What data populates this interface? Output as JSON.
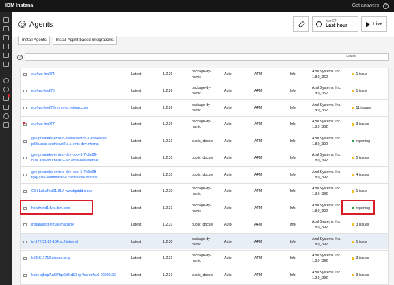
{
  "topbar": {
    "brand": "IBM Instana",
    "get_answers": "Get answers"
  },
  "header": {
    "title": "Agents",
    "time_date": "Mar 07",
    "time_range": "Last hour",
    "live_label": "Live"
  },
  "actions": {
    "install_agents": "Install Agents",
    "install_integrations": "Install Agent-based Integrations"
  },
  "toolbar": {
    "help_glyph": "?",
    "filters_label": "Filters"
  },
  "status_colors": {
    "warning": "#f1c21b",
    "ok": "#24a148"
  },
  "rows": [
    {
      "host": "eu-hws-lnx274",
      "version": "Latest",
      "agent_ver": "1.2.26",
      "pkg1": "package-dy-",
      "pkg2": "namic",
      "mode": "Auto",
      "type": "APM",
      "level": "Info",
      "jvm1": "Azul Systems, Inc.",
      "jvm2": "1.8.0_362",
      "status": "1 issue",
      "status_type": "warning"
    },
    {
      "host": "eu-hws-lnx275",
      "version": "Latest",
      "agent_ver": "1.2.26",
      "pkg1": "package-dy-",
      "pkg2": "namic",
      "mode": "Auto",
      "type": "APM",
      "level": "Info",
      "jvm1": "Azul Systems, Inc.",
      "jvm2": "1.8.0_362",
      "status": "1 issue",
      "status_type": "warning"
    },
    {
      "host": "eu-hws-lnx276.nonprod.hclpnp.com",
      "version": "Latest",
      "agent_ver": "1.2.26",
      "pkg1": "package-dy-",
      "pkg2": "namic",
      "mode": "Auto",
      "type": "APM",
      "level": "Info",
      "jvm1": "Azul Systems, Inc.",
      "jvm2": "1.8.0_362",
      "status": "11 issues",
      "status_type": "warning"
    },
    {
      "host": "eu-hws-lnx277",
      "version": "Latest",
      "agent_ver": "1.2.26",
      "pkg1": "package-dy-",
      "pkg2": "namic",
      "mode": "Auto",
      "type": "APM",
      "level": "Info",
      "jvm1": "Azul Systems, Inc.",
      "jvm2": "1.8.0_362",
      "status": "3 issues",
      "status_type": "warning",
      "alert": true
    },
    {
      "host": "gke-privateks-emis-d-elasticsearch-1-e5e4d2ad-",
      "host2": "p3da.asia-southeast2-a.c.emis-dev.internal",
      "version": "Latest",
      "agent_ver": "1.2.31",
      "pkg1": "public_docker",
      "pkg2": "",
      "mode": "Auto",
      "type": "APM",
      "level": "Info",
      "jvm1": "Azul Systems, Inc.",
      "jvm2": "1.8.0_392",
      "status": "reporting",
      "status_type": "ok"
    },
    {
      "host": "gke-privateks-emis-d-dev-pool-5-7fc8e9ff-",
      "host2": "b0fe.asia-southeast2-a.c.emis-dev.internal",
      "version": "Latest",
      "agent_ver": "1.2.31",
      "pkg1": "public_docker",
      "pkg2": "",
      "mode": "Auto",
      "type": "APM",
      "level": "Info",
      "jvm1": "Azul Systems, Inc.",
      "jvm2": "1.8.0_392",
      "status": "5 issues",
      "status_type": "warning"
    },
    {
      "host": "gke-privateks-emis-d-dev-pool-5-7fc8e9ff-",
      "host2": "tgky.asia-southeast2-a.c.emis-dev.internal",
      "version": "Latest",
      "agent_ver": "1.2.31",
      "pkg1": "public_docker",
      "pkg2": "",
      "mode": "Auto",
      "type": "APM",
      "level": "Info",
      "jvm1": "Azul Systems, Inc.",
      "jvm2": "1.8.0_392",
      "status": "4 issues",
      "status_type": "warning"
    },
    {
      "host": "GSI-LabsTest01.IBM-wwwbpddd.cloud",
      "version": "Latest",
      "agent_ver": "1.2.30",
      "pkg1": "package-dy-",
      "pkg2": "namic",
      "mode": "Auto",
      "type": "APM",
      "level": "Info",
      "jvm1": "Azul Systems, Inc.",
      "jvm2": "1.8.0_392",
      "status": "1 issue",
      "status_type": "warning"
    },
    {
      "host": "headwind1.fyre.ibm.com",
      "version": "Latest",
      "agent_ver": "1.2.31",
      "pkg1": "package-dy-",
      "pkg2": "namic",
      "mode": "Auto",
      "type": "APM",
      "level": "Info",
      "jvm1": "Azul Systems, Inc.",
      "jvm2": "1.8.0_392",
      "status": "reporting",
      "status_type": "ok"
    },
    {
      "host": "instanatest-virtual-machine",
      "version": "Latest",
      "agent_ver": "1.2.31",
      "pkg1": "public_docker",
      "pkg2": "",
      "mode": "Auto",
      "type": "APM",
      "level": "Info",
      "jvm1": "Azul Systems, Inc.",
      "jvm2": "1.8.0_392",
      "status": "3 issues",
      "status_type": "warning"
    },
    {
      "host": "ip-172-31-81-164.ec2.internal",
      "version": "Latest",
      "agent_ver": "1.2.30",
      "pkg1": "package-dy-",
      "pkg2": "namic",
      "mode": "Auto",
      "type": "APM",
      "level": "Info",
      "jvm1": "Azul Systems, Inc.",
      "jvm2": "1.8.0_392",
      "status": "1 issue",
      "status_type": "warning",
      "highlight": true
    },
    {
      "host": "krkDS11713.niandc.co.jp",
      "version": "Latest",
      "agent_ver": "1.2.31",
      "pkg1": "package-dy-",
      "pkg2": "namic",
      "mode": "Auto",
      "type": "APM",
      "level": "Info",
      "jvm1": "Azul Systems, Inc.",
      "jvm2": "1.8.0_392",
      "status": "3 issues",
      "status_type": "warning"
    },
    {
      "host": "kube-cjbop7ud07fqe9d8rd50-cp4ba-default-00000182",
      "version": "Latest",
      "agent_ver": "1.2.31",
      "pkg1": "public_docker",
      "pkg2": "",
      "mode": "Auto",
      "type": "APM",
      "level": "Info",
      "jvm1": "Azul Systems, Inc.",
      "jvm2": "1.8.0_392",
      "status": "3 issues",
      "status_type": "warning"
    }
  ]
}
